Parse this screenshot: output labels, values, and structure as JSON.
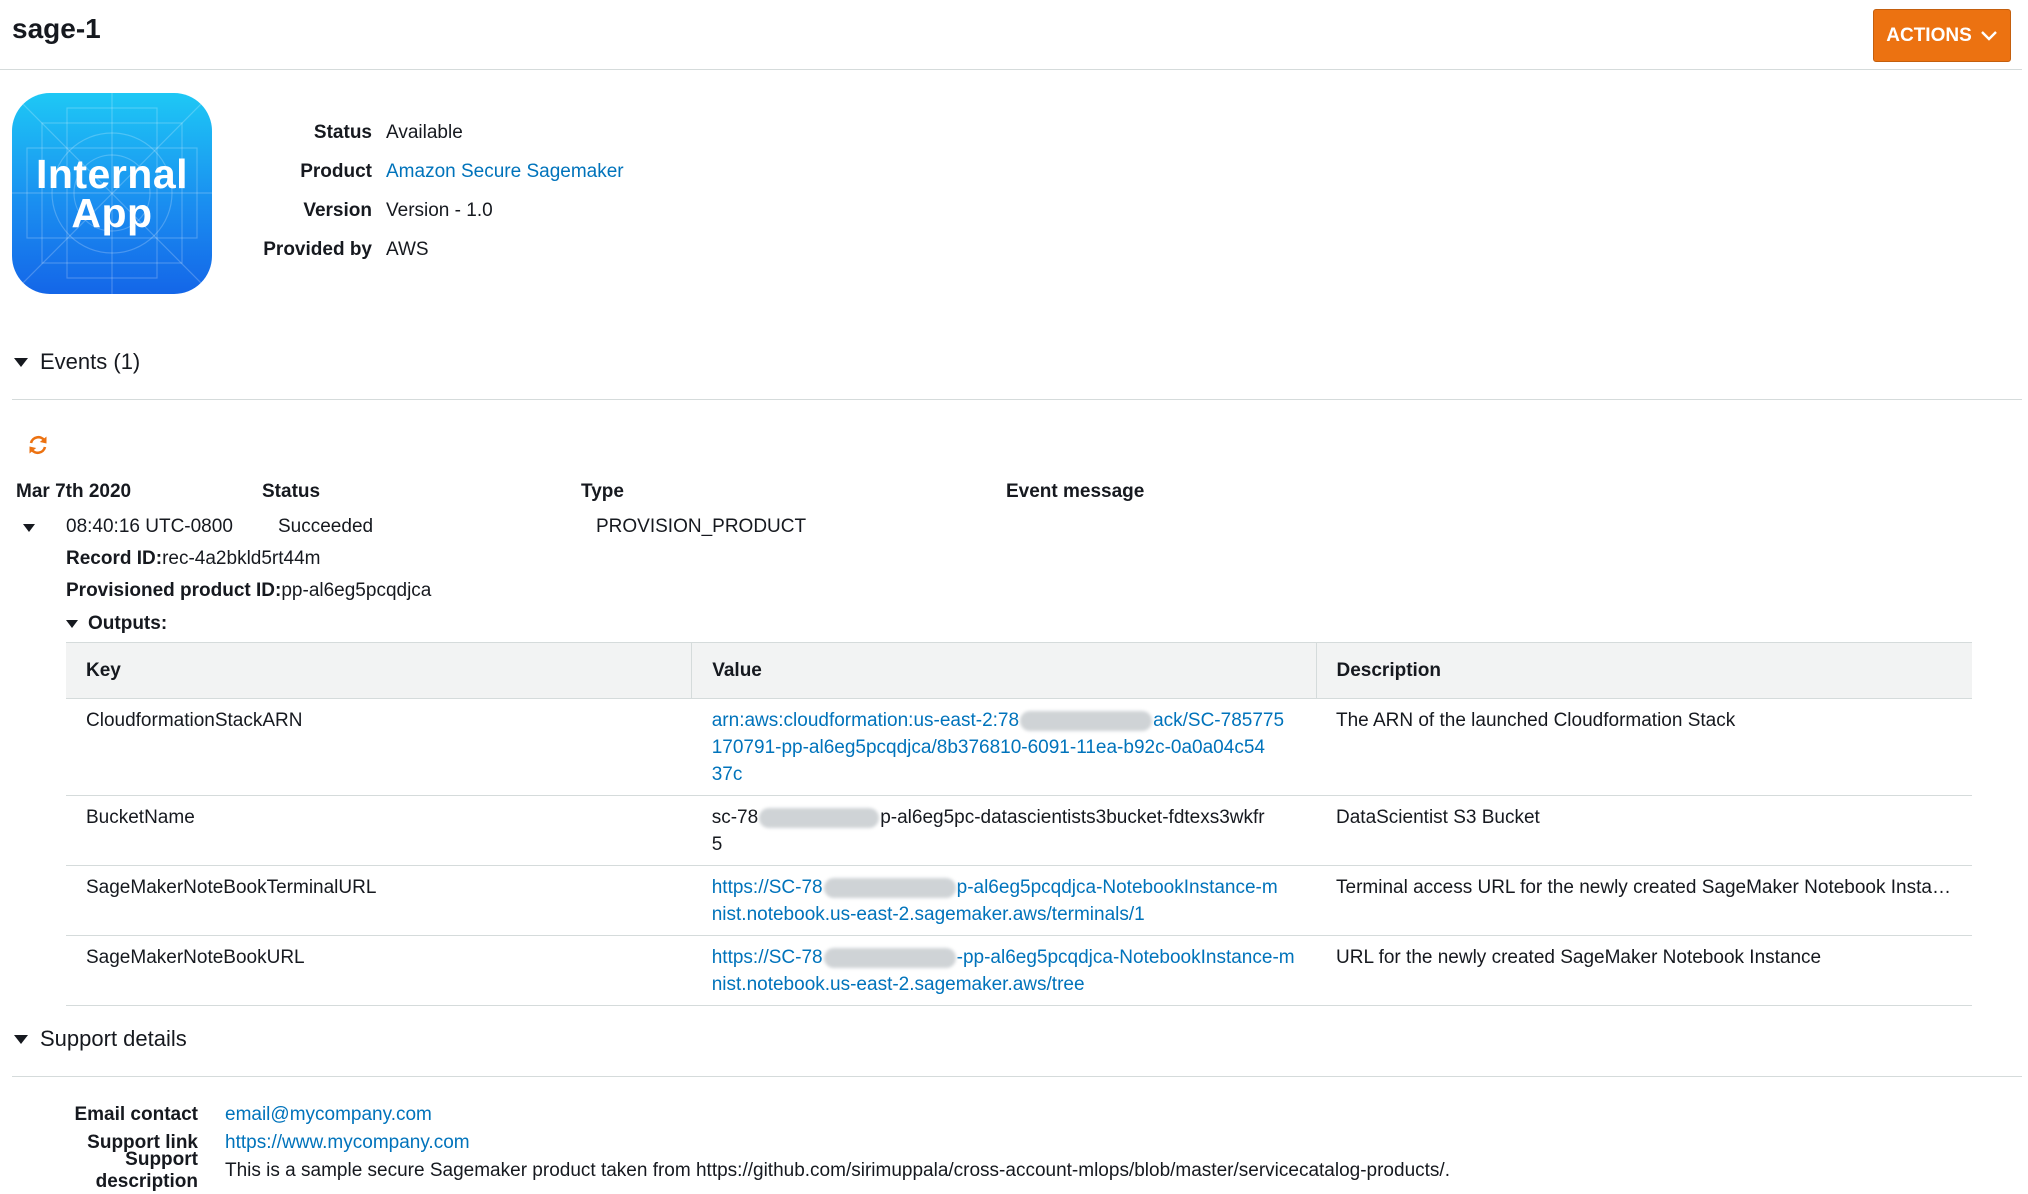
{
  "header": {
    "title": "sage-1",
    "actions_label": "ACTIONS"
  },
  "app_icon": {
    "line1": "Internal",
    "line2": "App"
  },
  "summary": {
    "status_label": "Status",
    "status_value": "Available",
    "product_label": "Product",
    "product_value": "Amazon Secure Sagemaker",
    "version_label": "Version",
    "version_value": "Version - 1.0",
    "provider_label": "Provided by",
    "provider_value": "AWS"
  },
  "events": {
    "title": "Events (1)",
    "columns": {
      "date": "Mar 7th 2020",
      "status": "Status",
      "type": "Type",
      "message": "Event message"
    },
    "row": {
      "time": "08:40:16 UTC-0800",
      "status": "Succeeded",
      "type": "PROVISION_PRODUCT"
    },
    "record_id_label": "Record ID:",
    "record_id_value": "rec-4a2bkld5rt44m",
    "pp_id_label": "Provisioned product ID:",
    "pp_id_value": "pp-al6eg5pcqdjca",
    "outputs_label": "Outputs:"
  },
  "outputs": {
    "headers": {
      "key": "Key",
      "value": "Value",
      "description": "Description"
    },
    "rows": [
      {
        "key": "CloudformationStackARN",
        "value_a": "arn:aws:cloudformation:us-east-2:78",
        "value_b": "ack/SC-785775",
        "value_c": "170791-pp-al6eg5pcqdjca/8b376810-6091-11ea-b92c-0a0a04c54",
        "value_d": "37c",
        "description": "The ARN of the launched Cloudformation Stack"
      },
      {
        "key": "BucketName",
        "value_a": "sc-78",
        "value_b": "p-al6eg5pc-datascientists3bucket-fdtexs3wkfr",
        "value_c": "5",
        "description": "DataScientist S3 Bucket"
      },
      {
        "key": "SageMakerNoteBookTerminalURL",
        "value_a": "https://SC-78",
        "value_b": "p-al6eg5pcqdjca-NotebookInstance-m",
        "value_c": "nist.notebook.us-east-2.sagemaker.aws/terminals/1",
        "description": "Terminal access URL for the newly created SageMaker Notebook Instance"
      },
      {
        "key": "SageMakerNoteBookURL",
        "value_a": "https://SC-78",
        "value_b": "-pp-al6eg5pcqdjca-NotebookInstance-m",
        "value_c": "nist.notebook.us-east-2.sagemaker.aws/tree",
        "description": "URL for the newly created SageMaker Notebook Instance"
      }
    ]
  },
  "support": {
    "title": "Support details",
    "email_label": "Email contact",
    "email_value": "email@mycompany.com",
    "link_label": "Support link",
    "link_value": "https://www.mycompany.com",
    "desc_label": "Support description",
    "desc_value": "This is a sample secure Sagemaker product taken from https://github.com/sirimuppala/cross-account-mlops/blob/master/servicecatalog-products/."
  },
  "colors": {
    "accent": "#ec7211",
    "link": "#0073bb",
    "border": "#d5dbdb",
    "header_bg": "#f2f3f3"
  },
  "icons": [
    "chevron-down-icon",
    "refresh-icon",
    "caret-down-icon"
  ]
}
